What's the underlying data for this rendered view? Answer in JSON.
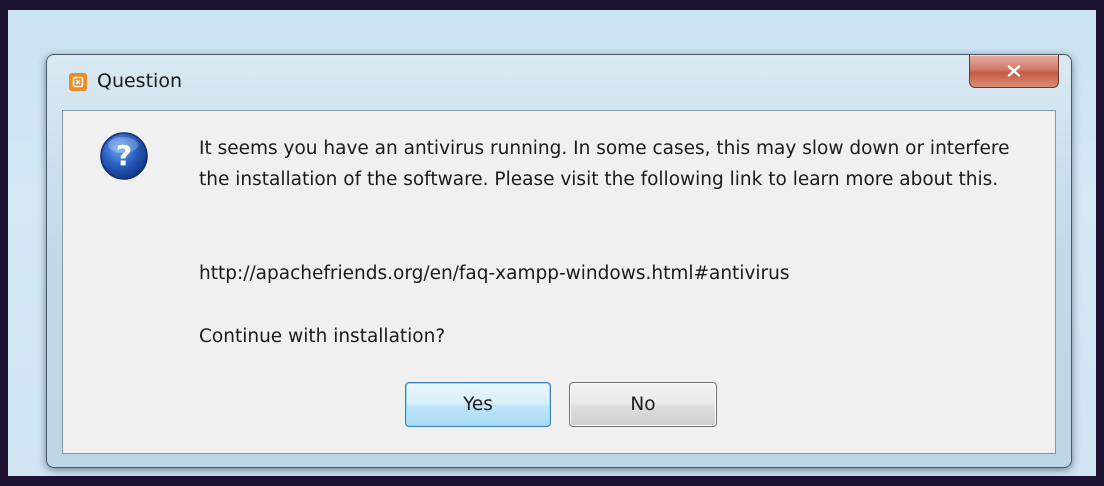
{
  "window": {
    "title": "Question",
    "close_label": "x"
  },
  "message": {
    "body": "It seems you have an antivirus running. In some cases, this may slow down or interfere the installation of the software. Please visit the following link to learn more about this.",
    "link": "http://apachefriends.org/en/faq-xampp-windows.html#antivirus",
    "question": "Continue with installation?"
  },
  "buttons": {
    "yes_label": "Yes",
    "no_label": "No"
  },
  "icons": {
    "app": "xampp-icon",
    "question": "question-icon",
    "close": "close-icon"
  },
  "colors": {
    "app_icon": "#f08a24",
    "question_icon": "#1f4fa8",
    "close_button": "#c65a44",
    "default_button_border": "#3c7fb1"
  }
}
